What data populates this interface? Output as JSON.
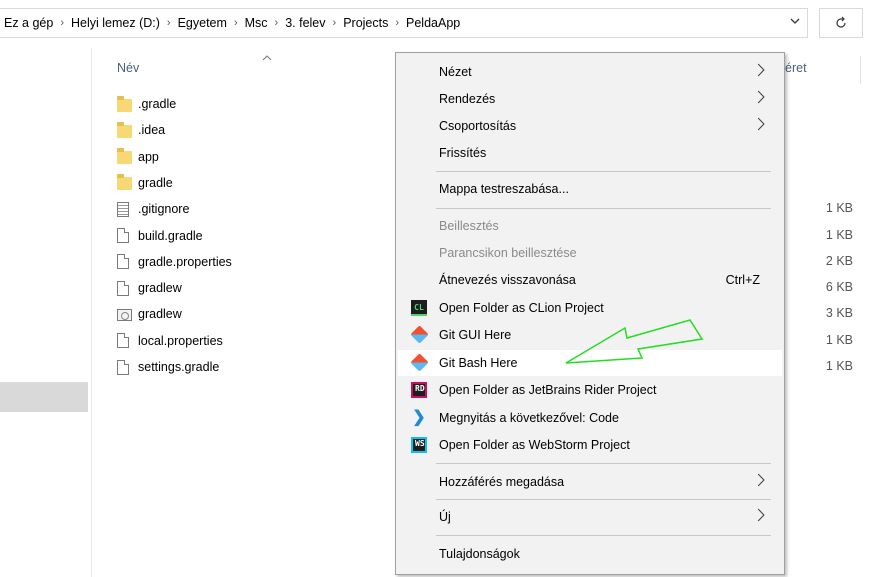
{
  "address_bar": {
    "crumbs": [
      "Ez a gép",
      "Helyi lemez (D:)",
      "Egyetem",
      "Msc",
      "3. felev",
      "Projects",
      "PeldaApp"
    ],
    "separator": "›",
    "dropdown_icon": "chevron-down-icon",
    "refresh_icon": "refresh-icon"
  },
  "columns": {
    "name": "Név",
    "size_partial": "éret",
    "sort_icon": "sort-ascending-icon"
  },
  "files": [
    {
      "name": ".gradle",
      "type": "folder",
      "size": ""
    },
    {
      "name": ".idea",
      "type": "folder",
      "size": ""
    },
    {
      "name": "app",
      "type": "folder",
      "size": ""
    },
    {
      "name": "gradle",
      "type": "folder",
      "size": ""
    },
    {
      "name": ".gitignore",
      "type": "text",
      "size": "1 KB"
    },
    {
      "name": "build.gradle",
      "type": "file",
      "size": "1 KB"
    },
    {
      "name": "gradle.properties",
      "type": "file",
      "size": "2 KB"
    },
    {
      "name": "gradlew",
      "type": "file",
      "size": "6 KB"
    },
    {
      "name": "gradlew",
      "type": "exe",
      "size": "3 KB"
    },
    {
      "name": "local.properties",
      "type": "file",
      "size": "1 KB"
    },
    {
      "name": "settings.gradle",
      "type": "file",
      "size": "1 KB"
    }
  ],
  "context_menu": {
    "items": [
      {
        "label": "Nézet",
        "submenu": true
      },
      {
        "label": "Rendezés",
        "submenu": true
      },
      {
        "label": "Csoportosítás",
        "submenu": true
      },
      {
        "label": "Frissítés"
      },
      {
        "label": "Mappa testreszabása..."
      },
      {
        "label": "Beillesztés",
        "disabled": true
      },
      {
        "label": "Parancsikon beillesztése",
        "disabled": true
      },
      {
        "label": "Átnevezés visszavonása",
        "shortcut": "Ctrl+Z"
      },
      {
        "label": "Open Folder as CLion Project",
        "icon": "clion-icon",
        "icon_text": "CL"
      },
      {
        "label": "Git GUI Here",
        "icon": "git-icon"
      },
      {
        "label": "Git Bash Here",
        "icon": "git-icon",
        "highlighted": true
      },
      {
        "label": "Open Folder as JetBrains Rider Project",
        "icon": "rider-icon",
        "icon_text": "RD"
      },
      {
        "label": "Megnyitás a következővel: Code",
        "icon": "vscode-icon"
      },
      {
        "label": "Open Folder as WebStorm Project",
        "icon": "webstorm-icon",
        "icon_text": "WS"
      },
      {
        "label": "Hozzáférés megadása",
        "submenu": true
      },
      {
        "label": "Új",
        "submenu": true
      },
      {
        "label": "Tulajdonságok"
      }
    ]
  },
  "annotation": {
    "type": "arrow",
    "color": "#22dd22",
    "points_to": "Git Bash Here"
  }
}
